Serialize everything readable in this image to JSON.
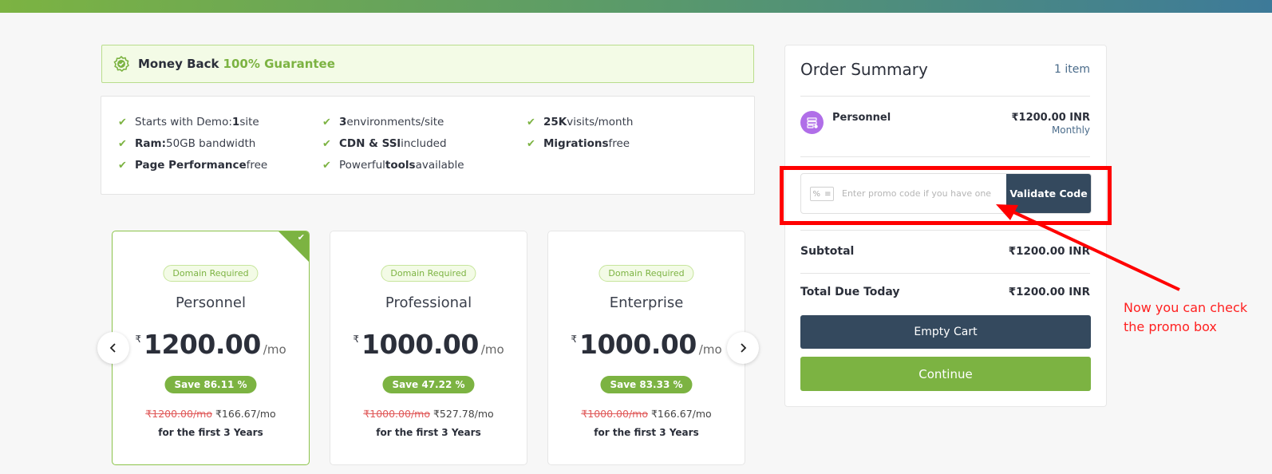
{
  "colors": {
    "accent": "#7cb342",
    "dark": "#34495e",
    "annotation": "#ff0000"
  },
  "guarantee": {
    "prefix": "Money Back",
    "highlight": "100% Guarantee",
    "icon": "shield-check-badge-icon"
  },
  "features": [
    {
      "pre": "Starts with Demo: ",
      "bold": "1",
      "post": " site"
    },
    {
      "pre": "",
      "bold": "3",
      "post": " environments/site"
    },
    {
      "pre": "",
      "bold": "25K",
      "post": " visits/month"
    },
    {
      "pre": "",
      "bold": "Ram:",
      "post": " 50GB bandwidth"
    },
    {
      "pre": "",
      "bold": "CDN & SSl",
      "post": " included"
    },
    {
      "pre": "",
      "bold": "Migrations",
      "post": " free"
    },
    {
      "pre": "",
      "bold": "Page Performance",
      "post": " free"
    },
    {
      "pre": "Powerful ",
      "bold": "tools",
      "post": " available"
    }
  ],
  "plans": [
    {
      "tag": "Domain Required",
      "name": "Personnel",
      "currency": "₹",
      "amount": "1200.00",
      "per": "/mo",
      "save": "Save 86.11 %",
      "old": "₹1200.00/mo",
      "new": " ₹166.67/mo",
      "term": "for the first 3 Years",
      "selected": true
    },
    {
      "tag": "Domain Required",
      "name": "Professional",
      "currency": "₹",
      "amount": "1000.00",
      "per": "/mo",
      "save": "Save 47.22 %",
      "old": "₹1000.00/mo",
      "new": " ₹527.78/mo",
      "term": "for the first 3 Years",
      "selected": false
    },
    {
      "tag": "Domain Required",
      "name": "Enterprise",
      "currency": "₹",
      "amount": "1000.00",
      "per": "/mo",
      "save": "Save 83.33 %",
      "old": "₹1000.00/mo",
      "new": " ₹166.67/mo",
      "term": "for the first 3 Years",
      "selected": false
    }
  ],
  "summary": {
    "title": "Order Summary",
    "count": "1 item",
    "item": {
      "name": "Personnel",
      "price": "₹1200.00 INR",
      "cycle": "Monthly",
      "icon": "server-gear-icon"
    },
    "promo": {
      "placeholder": "Enter promo code if you have one",
      "button": "Validate Code",
      "icon": "coupon-icon"
    },
    "subtotal_label": "Subtotal",
    "subtotal_value": "₹1200.00 INR",
    "total_label": "Total Due Today",
    "total_value": "₹1200.00 INR",
    "empty_cart": "Empty Cart",
    "continue": "Continue"
  },
  "annotation": {
    "text": "Now you can check the promo box"
  }
}
